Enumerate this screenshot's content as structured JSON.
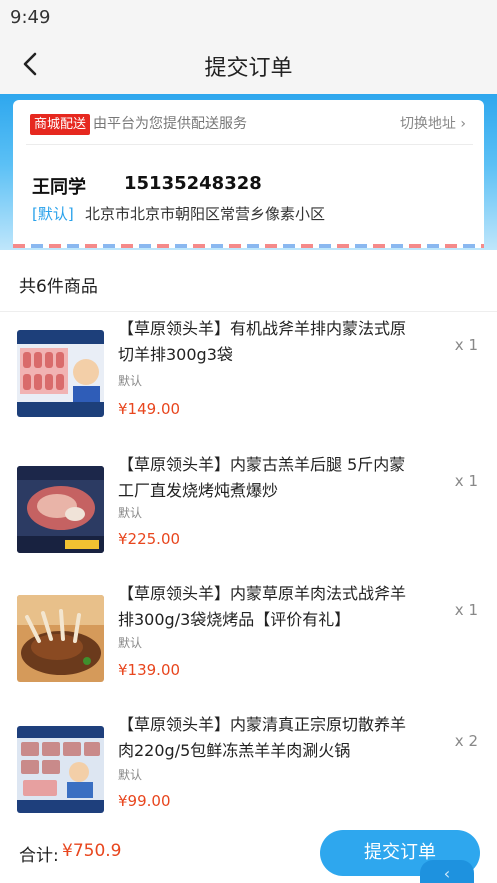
{
  "status_bar": {
    "time": "9:49"
  },
  "nav": {
    "title": "提交订单",
    "back_icon": "chevron-left-icon"
  },
  "address": {
    "ship_tag": "商城配送",
    "ship_desc": "由平台为您提供配送服务",
    "switch_label": "切换地址 ›",
    "name": "王同学",
    "phone": "15135248328",
    "default_tag": "[默认]",
    "address_text": "北京市北京市朝阳区常营乡像素小区"
  },
  "goods": {
    "count_label": "共6件商品",
    "items": [
      {
        "title": "【草原领头羊】有机战斧羊排内蒙法式原切羊排300g3袋",
        "spec": "默认",
        "price": "¥149.00",
        "qty": "x 1"
      },
      {
        "title": "【草原领头羊】内蒙古羔羊后腿 5斤内蒙工厂直发烧烤炖煮爆炒",
        "spec": "默认",
        "price": "¥225.00",
        "qty": "x 1"
      },
      {
        "title": "【草原领头羊】内蒙草原羊肉法式战斧羊排300g/3袋烧烤品【评价有礼】",
        "spec": "默认",
        "price": "¥139.00",
        "qty": "x 1"
      },
      {
        "title": "【草原领头羊】内蒙清真正宗原切散养羊肉220g/5包鲜冻羔羊羊肉涮火锅",
        "spec": "默认",
        "price": "¥99.00",
        "qty": "x 2"
      }
    ]
  },
  "footer": {
    "total_label": "合计:",
    "total_value": "¥750.9",
    "submit_label": "提交订单",
    "float_icon": "chevron-left-icon"
  },
  "colors": {
    "accent": "#2ea7ee",
    "price": "#e8461e",
    "tag_red": "#e6281f"
  }
}
